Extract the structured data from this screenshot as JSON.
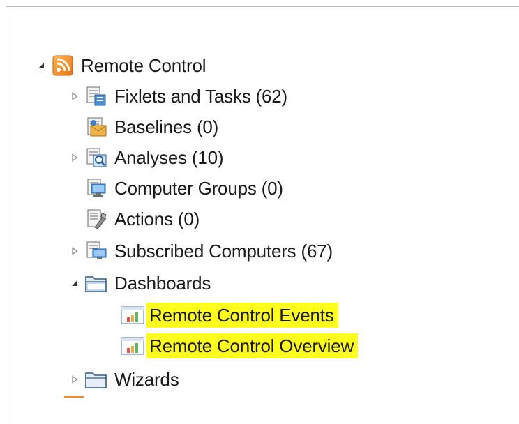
{
  "tree": {
    "root": {
      "label": "Remote Control",
      "icon": "rss-feed-icon",
      "expanded": true,
      "accent": "#f7931e"
    },
    "items": [
      {
        "label": "Fixlets and Tasks (62)",
        "icon": "fixlets-icon",
        "toggle": "collapsed"
      },
      {
        "label": "Baselines (0)",
        "icon": "baselines-icon",
        "toggle": "none"
      },
      {
        "label": "Analyses (10)",
        "icon": "analyses-icon",
        "toggle": "collapsed"
      },
      {
        "label": "Computer Groups (0)",
        "icon": "computer-groups-icon",
        "toggle": "none"
      },
      {
        "label": "Actions (0)",
        "icon": "actions-icon",
        "toggle": "none"
      },
      {
        "label": "Subscribed Computers (67)",
        "icon": "subscribed-computers-icon",
        "toggle": "collapsed"
      },
      {
        "label": "Dashboards",
        "icon": "folder-icon",
        "toggle": "expanded"
      },
      {
        "label": "Wizards",
        "icon": "folder-icon",
        "toggle": "collapsed"
      }
    ],
    "dashboards": [
      {
        "label": "Remote Control Events",
        "icon": "dashboard-chart-icon",
        "highlighted": true
      },
      {
        "label": "Remote Control Overview",
        "icon": "dashboard-chart-icon",
        "highlighted": true
      }
    ],
    "highlight_color": "#ffff1e"
  }
}
